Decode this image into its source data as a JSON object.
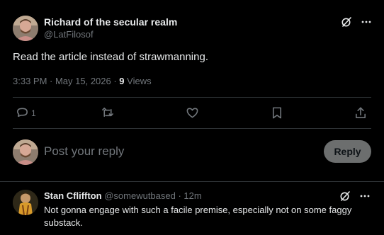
{
  "post": {
    "author_name": "Richard of the secular realm",
    "author_handle": "@LatFilosof",
    "text": "Read the article instead of strawmanning.",
    "time": "3:33 PM · May 15, 2026 · ",
    "views_count": "9",
    "views_label": " Views",
    "reply_count": "1",
    "icons": {
      "grok": "grok-icon",
      "more": "more-icon",
      "reply": "reply-icon",
      "retweet": "retweet-icon",
      "like": "like-icon",
      "bookmark": "bookmark-icon",
      "share": "share-icon"
    }
  },
  "composer": {
    "placeholder": "Post your reply",
    "button_label": "Reply"
  },
  "comment": {
    "author_name": "Stan Cfliffton",
    "author_handle": "@somewutbased",
    "time": " · 12m",
    "text": "Not gonna engage with such a facile premise, especially not on some faggy substack."
  },
  "colors": {
    "background": "#000000",
    "text": "#e7e9ea",
    "muted": "#71767b",
    "divider": "#2f3336",
    "reply_button": "#787a7a"
  }
}
